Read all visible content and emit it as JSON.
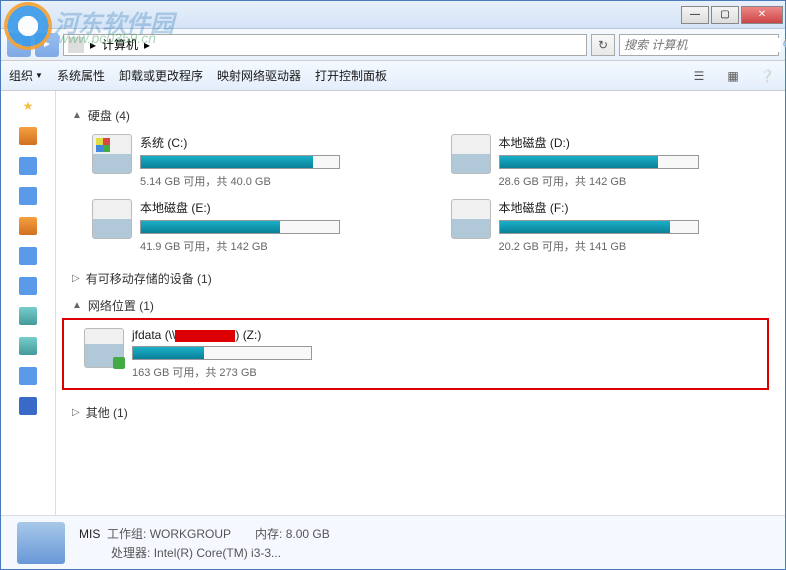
{
  "window": {
    "min": "—",
    "max": "▢",
    "close": "✕"
  },
  "nav": {
    "back": "◄",
    "fwd": "►",
    "location_label": "计算机",
    "path_sep": "▸",
    "refresh": "↻",
    "search_placeholder": "搜索 计算机",
    "search_icon": "🔍"
  },
  "toolbar": {
    "organize": "组织",
    "properties": "系统属性",
    "uninstall": "卸载或更改程序",
    "map_drive": "映射网络驱动器",
    "control_panel": "打开控制面板"
  },
  "sections": {
    "hdd": "硬盘 (4)",
    "removable": "有可移动存储的设备 (1)",
    "network": "网络位置 (1)",
    "other": "其他 (1)"
  },
  "drives": [
    {
      "name": "系统 (C:)",
      "free": "5.14 GB 可用，共 40.0 GB",
      "fill": 87
    },
    {
      "name": "本地磁盘 (D:)",
      "free": "28.6 GB 可用，共 142 GB",
      "fill": 80
    },
    {
      "name": "本地磁盘 (E:)",
      "free": "41.9 GB 可用，共 142 GB",
      "fill": 70
    },
    {
      "name": "本地磁盘 (F:)",
      "free": "20.2 GB 可用，共 141 GB",
      "fill": 86
    }
  ],
  "network_drive": {
    "name_prefix": "jfdata (\\\\",
    "name_suffix": ") (Z:)",
    "free": "163 GB 可用，共 273 GB",
    "fill": 40
  },
  "footer": {
    "name": "MIS",
    "workgroup_label": "工作组:",
    "workgroup": "WORKGROUP",
    "mem_label": "内存:",
    "mem": "8.00 GB",
    "cpu_label": "处理器:",
    "cpu": "Intel(R) Core(TM) i3-3..."
  },
  "watermark": {
    "text": "河东软件园",
    "url": "www.pc0359.cn"
  }
}
